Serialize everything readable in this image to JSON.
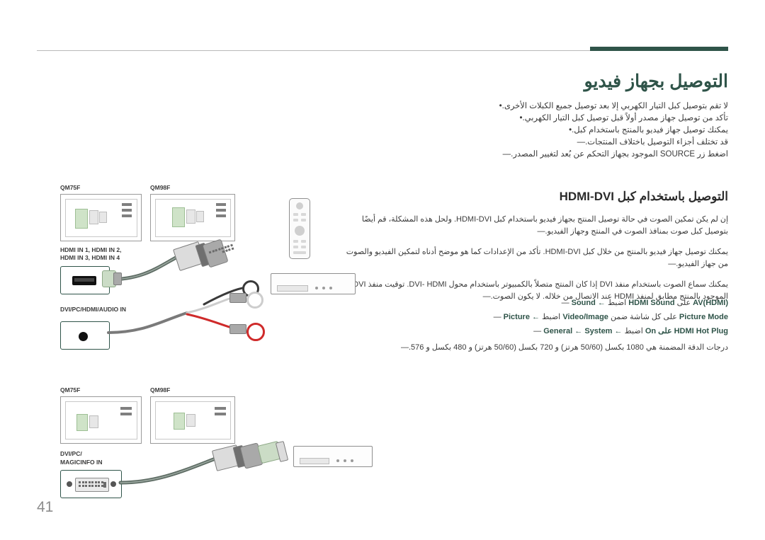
{
  "document": {
    "page_number": "41",
    "title": "التوصيل بجهاز فيديو",
    "section_title": "التوصيل باستخدام كبل HDMI-DVI"
  },
  "intro": {
    "bullets": [
      "لا تقم بتوصيل كبل التيار الكهربي إلا بعد توصيل جميع الكبلات الأخرى.",
      "تأكد من توصيل جهاز مصدر أولاً قبل توصيل كبل التيار الكهربي."
    ],
    "bullet2": "يمكنك توصيل جهاز فيديو بالمنتج باستخدام كبل.",
    "dashes": [
      "قد تختلف أجزاء التوصيل باختلاف المنتجات.",
      "اضغط زر SOURCE الموجود بجهاز التحكم عن بُعد لتغيير المصدر."
    ]
  },
  "body": {
    "paragraphs": [
      "إن لم يكن تمكين الصوت في حالة توصيل المنتج بجهاز فيديو باستخدام كبل HDMI-DVI. ولحل هذه المشكلة، قم أيضًا بتوصيل كبل صوت بمنافذ الصوت في المنتج وجهاز الفيديو.",
      "يمكنك توصيل جهاز فيديو بالمنتج من خلال كبل HDMI-DVI. تأكد من الإعدادات كما هو موضح أدناه لتمكين الفيديو والصوت من جهاز الفيديو.",
      "يمكنك سماع الصوت باستخدام منفذ DVI إذا كان المنتج متصلاً بالكمبيوتر باستخدام محول DVI- HDMI. توقيت منفذ DVI الموجود بالمنتج مطابق لمنفذ HDMI عند الاتصال من خلاله. لا يكون الصوت."
    ],
    "menu_items": [
      {
        "prefix": "اضبط",
        "bold1": "Sound",
        "arrow": "←",
        "bold2": "HDMI Sound",
        "suffix": "على",
        "tail": "AV(HDMI)"
      },
      {
        "prefix": "اضبط",
        "bold1": "Picture",
        "arrow": "←",
        "bold2": "Video/Image",
        "suffix": "على كل شاشة ضمن",
        "tail": "Picture Mode"
      },
      {
        "prefix": "اضبط",
        "bold1": "System",
        "arrow": "←",
        "bold2": "General",
        "suffix": "←",
        "tail": "HDMI Hot Plug على On"
      }
    ],
    "resolution_note": "درجات الدقة المضمنة هي 1080 بكسل (50/60 هرتز) و 720 بكسل (50/60 هرتز) و 480 بكسل و 576."
  },
  "illustration": {
    "top": {
      "model_left": "QM75F",
      "model_right": "QM98F",
      "port_label_line1": "HDMI IN 1, HDMI IN 2,",
      "port_label_line2": "HDMI IN 3, HDMI IN 4",
      "audio_port_label": "DVI/PC/HDMI/AUDIO IN"
    },
    "bottom": {
      "model_left": "QM75F",
      "model_right": "QM98F",
      "port_label_line1": "DVI/PC/",
      "port_label_line2": "MAGICINFO IN"
    }
  },
  "colors": {
    "accent": "#2f5449",
    "rule": "#b9b9b9",
    "text": "#3a3a3a",
    "page_number": "#8d8d8d",
    "port_green": "#cfe3c8",
    "rca_red": "#cf2a2a"
  }
}
